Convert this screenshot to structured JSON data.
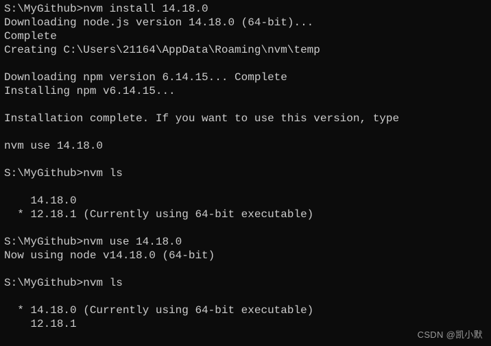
{
  "terminal": {
    "background_color": "#0c0c0c",
    "text_color": "#cccccc",
    "prompt": "S:\\MyGithub>",
    "lines": [
      {
        "id": "cmd-nvm-install",
        "text": "S:\\MyGithub>nvm install 14.18.0"
      },
      {
        "id": "out-downloading-node",
        "text": "Downloading node.js version 14.18.0 (64-bit)..."
      },
      {
        "id": "out-complete",
        "text": "Complete"
      },
      {
        "id": "out-creating-temp",
        "text": "Creating C:\\Users\\21164\\AppData\\Roaming\\nvm\\temp"
      },
      {
        "id": "blank-1",
        "text": ""
      },
      {
        "id": "out-downloading-npm",
        "text": "Downloading npm version 6.14.15... Complete"
      },
      {
        "id": "out-installing-npm",
        "text": "Installing npm v6.14.15..."
      },
      {
        "id": "blank-2",
        "text": ""
      },
      {
        "id": "out-installation-complete",
        "text": "Installation complete. If you want to use this version, type"
      },
      {
        "id": "blank-3",
        "text": ""
      },
      {
        "id": "out-hint-nvm-use",
        "text": "nvm use 14.18.0"
      },
      {
        "id": "blank-4",
        "text": ""
      },
      {
        "id": "cmd-nvm-ls-1",
        "text": "S:\\MyGithub>nvm ls"
      },
      {
        "id": "blank-5",
        "text": ""
      },
      {
        "id": "ls1-version-14",
        "text": "    14.18.0"
      },
      {
        "id": "ls1-version-12-current",
        "text": "  * 12.18.1 (Currently using 64-bit executable)"
      },
      {
        "id": "blank-6",
        "text": ""
      },
      {
        "id": "cmd-nvm-use",
        "text": "S:\\MyGithub>nvm use 14.18.0"
      },
      {
        "id": "out-now-using",
        "text": "Now using node v14.18.0 (64-bit)"
      },
      {
        "id": "blank-7",
        "text": ""
      },
      {
        "id": "cmd-nvm-ls-2",
        "text": "S:\\MyGithub>nvm ls"
      },
      {
        "id": "blank-8",
        "text": ""
      },
      {
        "id": "ls2-version-14-current",
        "text": "  * 14.18.0 (Currently using 64-bit executable)"
      },
      {
        "id": "ls2-version-12",
        "text": "    12.18.1"
      }
    ]
  },
  "watermark": {
    "text": "CSDN @凯小默",
    "color": "#9b9b9b"
  }
}
